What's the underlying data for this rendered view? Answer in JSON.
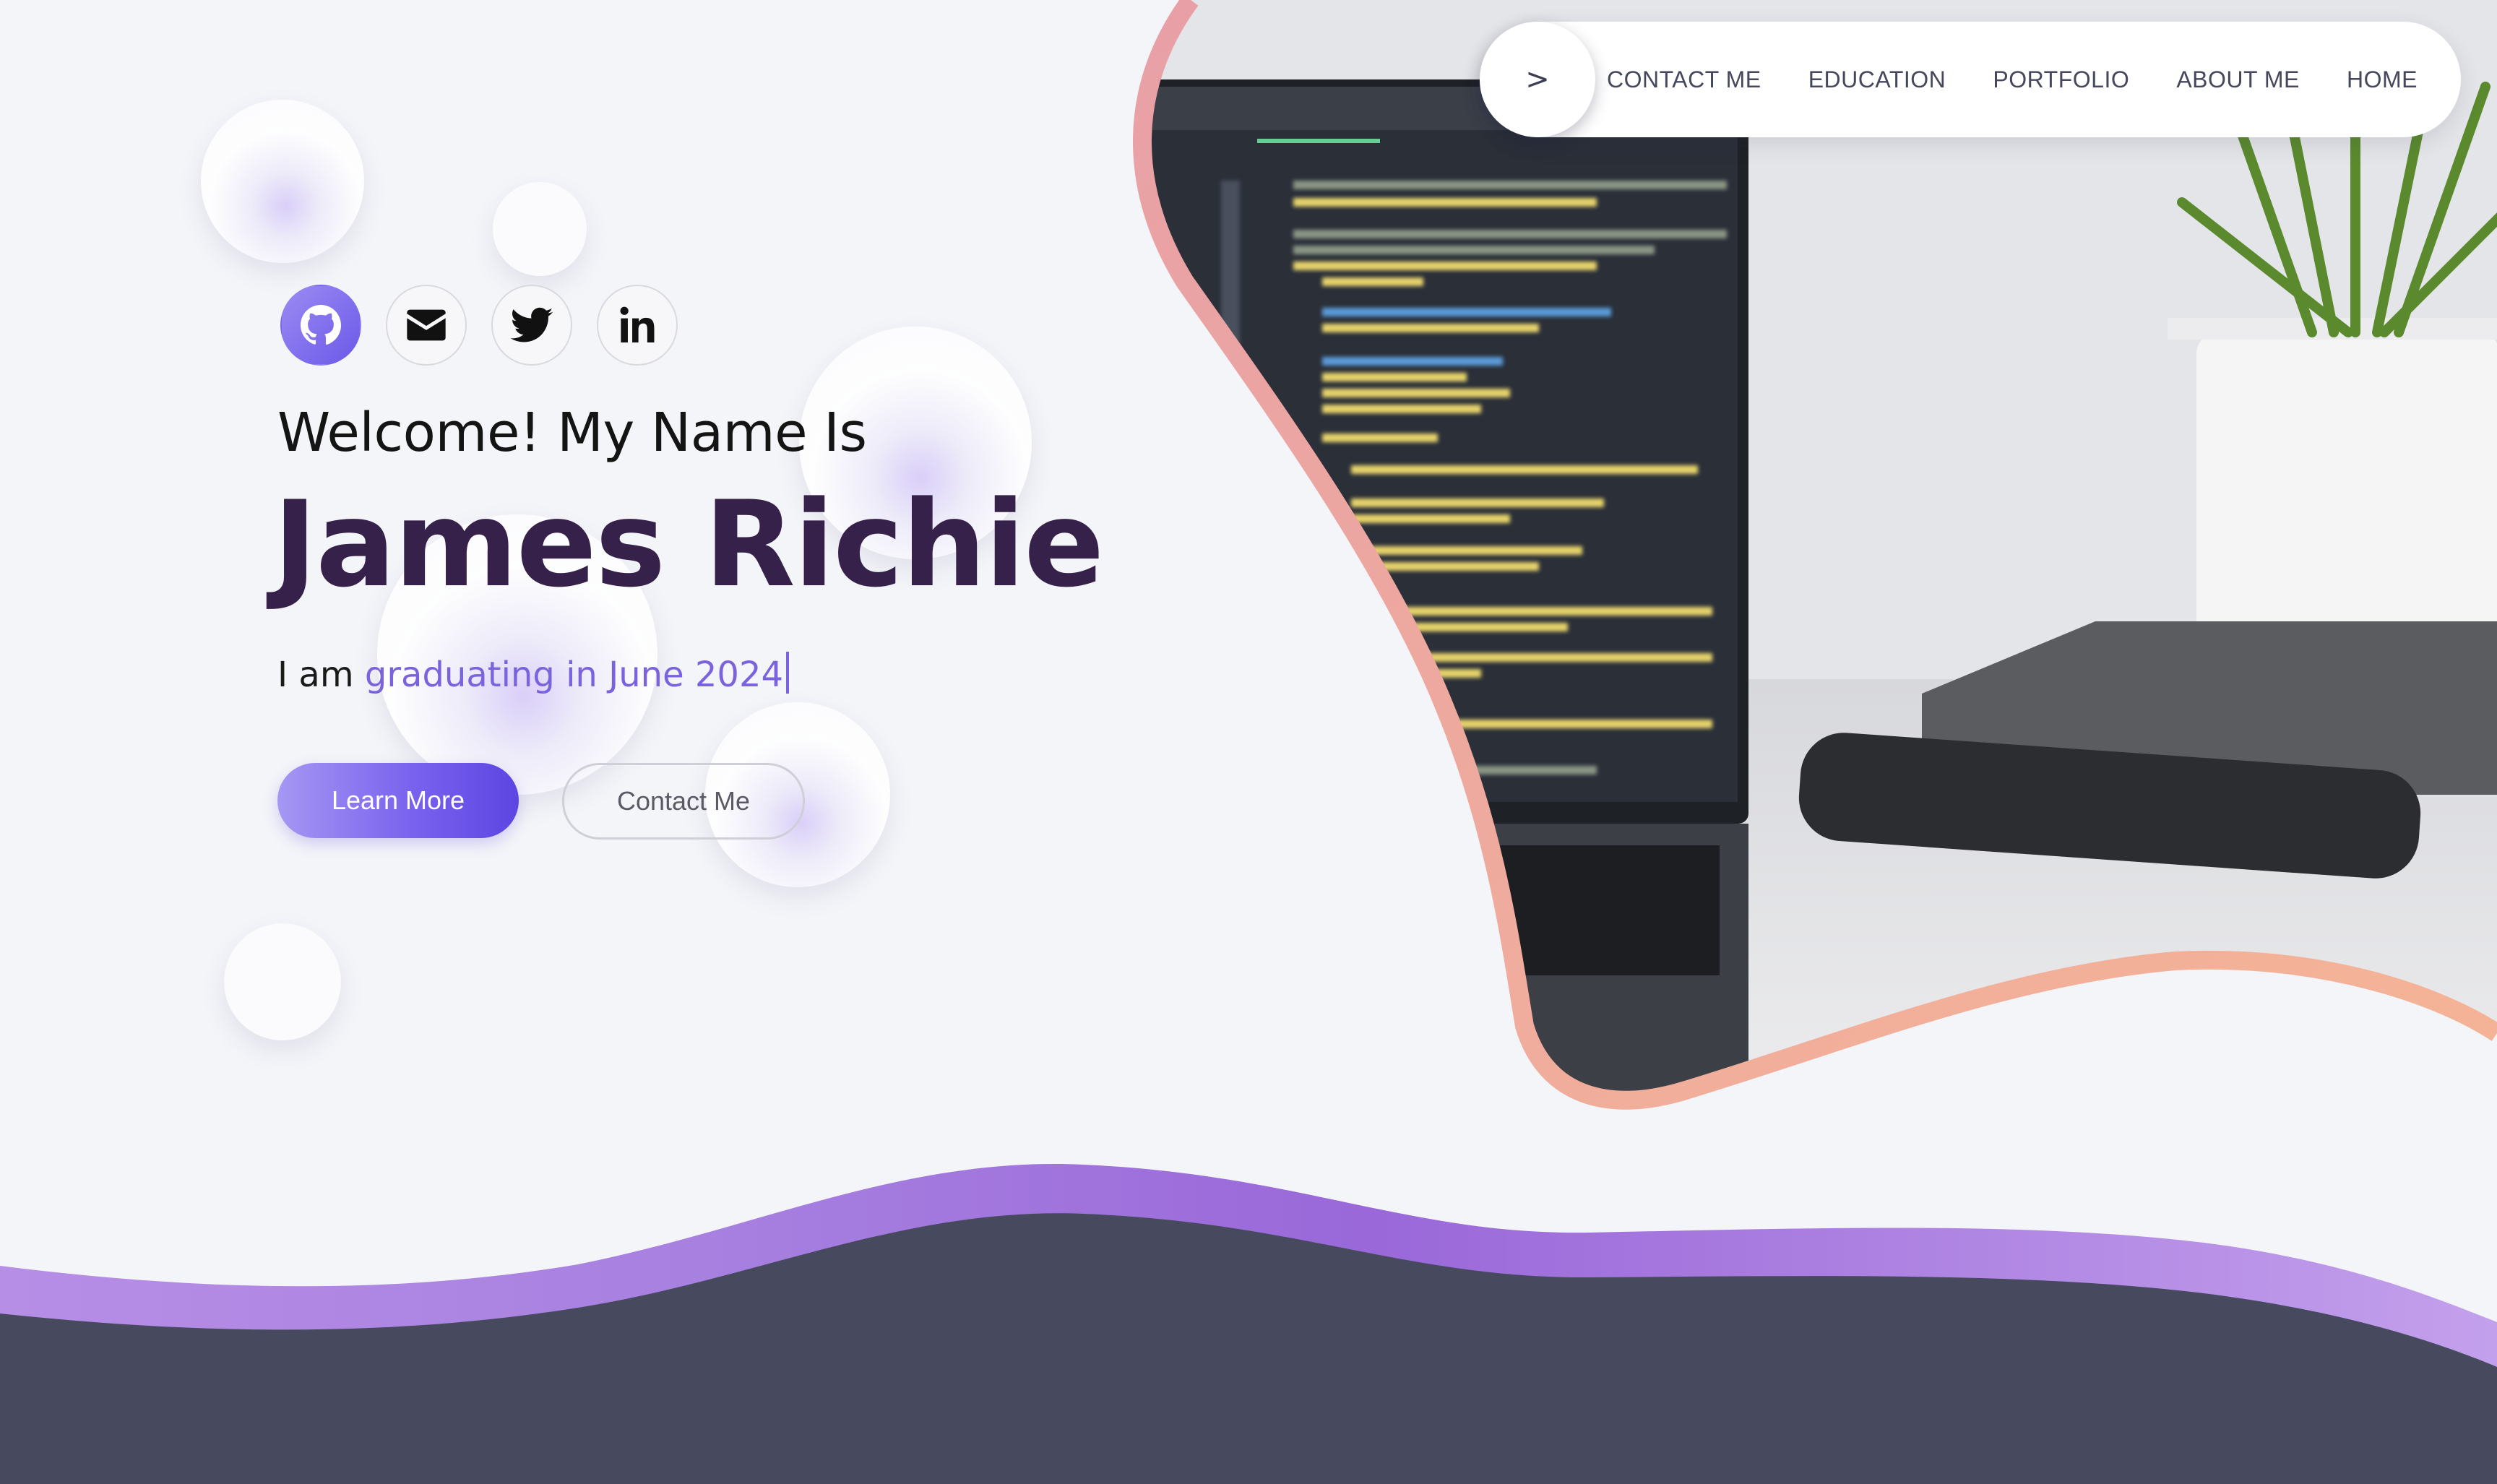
{
  "nav": {
    "toggle_label": ">",
    "links": [
      "CONTACT ME",
      "EDUCATION",
      "PORTFOLIO",
      "ABOUT ME",
      "HOME"
    ]
  },
  "socials": [
    {
      "name": "github-icon",
      "active": true
    },
    {
      "name": "email-icon",
      "active": false
    },
    {
      "name": "twitter-icon",
      "active": false
    },
    {
      "name": "linkedin-icon",
      "active": false
    }
  ],
  "hero": {
    "greeting": "Welcome! My Name Is",
    "name": "James Richie",
    "tagline_prefix": "I am ",
    "tagline_typed": "graduating in June 2024"
  },
  "buttons": {
    "learn_more": "Learn More",
    "contact_me": "Contact Me"
  },
  "colors": {
    "accent": "#7a63dc",
    "name": "#35214a",
    "footer": "#474a5f",
    "wave_purple": "#9a6ad8",
    "blob_border": "#f0a9a0"
  }
}
